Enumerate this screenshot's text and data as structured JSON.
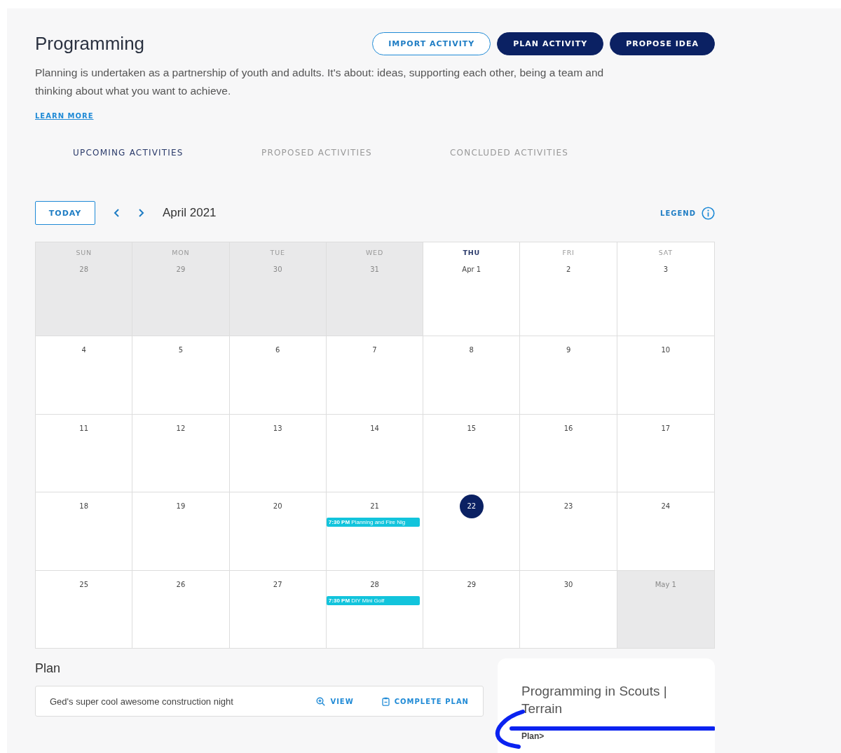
{
  "header": {
    "title": "Programming",
    "description": "Planning is undertaken as a partnership of youth and adults. It's about: ideas, supporting each other, being a team and thinking about what you want to achieve.",
    "learn_more": "LEARN MORE",
    "buttons": [
      {
        "label": "IMPORT ACTIVITY",
        "kind": "outline"
      },
      {
        "label": "PLAN ACTIVITY",
        "kind": "filled"
      },
      {
        "label": "PROPOSE IDEA",
        "kind": "filled"
      }
    ]
  },
  "tabs": [
    {
      "label": "UPCOMING ACTIVITIES",
      "selected": true
    },
    {
      "label": "PROPOSED ACTIVITIES",
      "selected": false
    },
    {
      "label": "CONCLUDED ACTIVITIES",
      "selected": false
    }
  ],
  "calendar": {
    "today_button": "TODAY",
    "month": "April 2021",
    "legend": "LEGEND",
    "weekdays": [
      {
        "label": "SUN",
        "current": false
      },
      {
        "label": "MON",
        "current": false
      },
      {
        "label": "TUE",
        "current": false
      },
      {
        "label": "WED",
        "current": false
      },
      {
        "label": "THU",
        "current": true
      },
      {
        "label": "FRI",
        "current": false
      },
      {
        "label": "SAT",
        "current": false
      }
    ],
    "weeks": [
      [
        {
          "label": "28",
          "outside": true,
          "today": false
        },
        {
          "label": "29",
          "outside": true,
          "today": false
        },
        {
          "label": "30",
          "outside": true,
          "today": false
        },
        {
          "label": "31",
          "outside": true,
          "today": false
        },
        {
          "label": "Apr 1",
          "outside": false,
          "today": false
        },
        {
          "label": "2",
          "outside": false,
          "today": false
        },
        {
          "label": "3",
          "outside": false,
          "today": false
        }
      ],
      [
        {
          "label": "4",
          "outside": false,
          "today": false
        },
        {
          "label": "5",
          "outside": false,
          "today": false
        },
        {
          "label": "6",
          "outside": false,
          "today": false
        },
        {
          "label": "7",
          "outside": false,
          "today": false
        },
        {
          "label": "8",
          "outside": false,
          "today": false
        },
        {
          "label": "9",
          "outside": false,
          "today": false
        },
        {
          "label": "10",
          "outside": false,
          "today": false
        }
      ],
      [
        {
          "label": "11",
          "outside": false,
          "today": false
        },
        {
          "label": "12",
          "outside": false,
          "today": false
        },
        {
          "label": "13",
          "outside": false,
          "today": false
        },
        {
          "label": "14",
          "outside": false,
          "today": false
        },
        {
          "label": "15",
          "outside": false,
          "today": false
        },
        {
          "label": "16",
          "outside": false,
          "today": false
        },
        {
          "label": "17",
          "outside": false,
          "today": false
        }
      ],
      [
        {
          "label": "18",
          "outside": false,
          "today": false
        },
        {
          "label": "19",
          "outside": false,
          "today": false
        },
        {
          "label": "20",
          "outside": false,
          "today": false
        },
        {
          "label": "21",
          "outside": false,
          "today": false,
          "events": [
            {
              "time": "7:30 PM",
              "title": "Planning and Fire Nig"
            }
          ]
        },
        {
          "label": "22",
          "outside": false,
          "today": true
        },
        {
          "label": "23",
          "outside": false,
          "today": false
        },
        {
          "label": "24",
          "outside": false,
          "today": false
        }
      ],
      [
        {
          "label": "25",
          "outside": false,
          "today": false
        },
        {
          "label": "26",
          "outside": false,
          "today": false
        },
        {
          "label": "27",
          "outside": false,
          "today": false
        },
        {
          "label": "28",
          "outside": false,
          "today": false,
          "events": [
            {
              "time": "7:30 PM",
              "title": "DIY Mini Golf"
            }
          ]
        },
        {
          "label": "29",
          "outside": false,
          "today": false
        },
        {
          "label": "30",
          "outside": false,
          "today": false
        },
        {
          "label": "May 1",
          "outside": true,
          "today": false
        }
      ]
    ]
  },
  "plan": {
    "heading": "Plan",
    "items": [
      {
        "name": "Ged's super cool awesome construction night",
        "view": "VIEW",
        "complete": "COMPLETE PLAN"
      }
    ]
  },
  "info_card": {
    "title": "Programming in Scouts | Terrain",
    "link": "Plan>"
  }
}
